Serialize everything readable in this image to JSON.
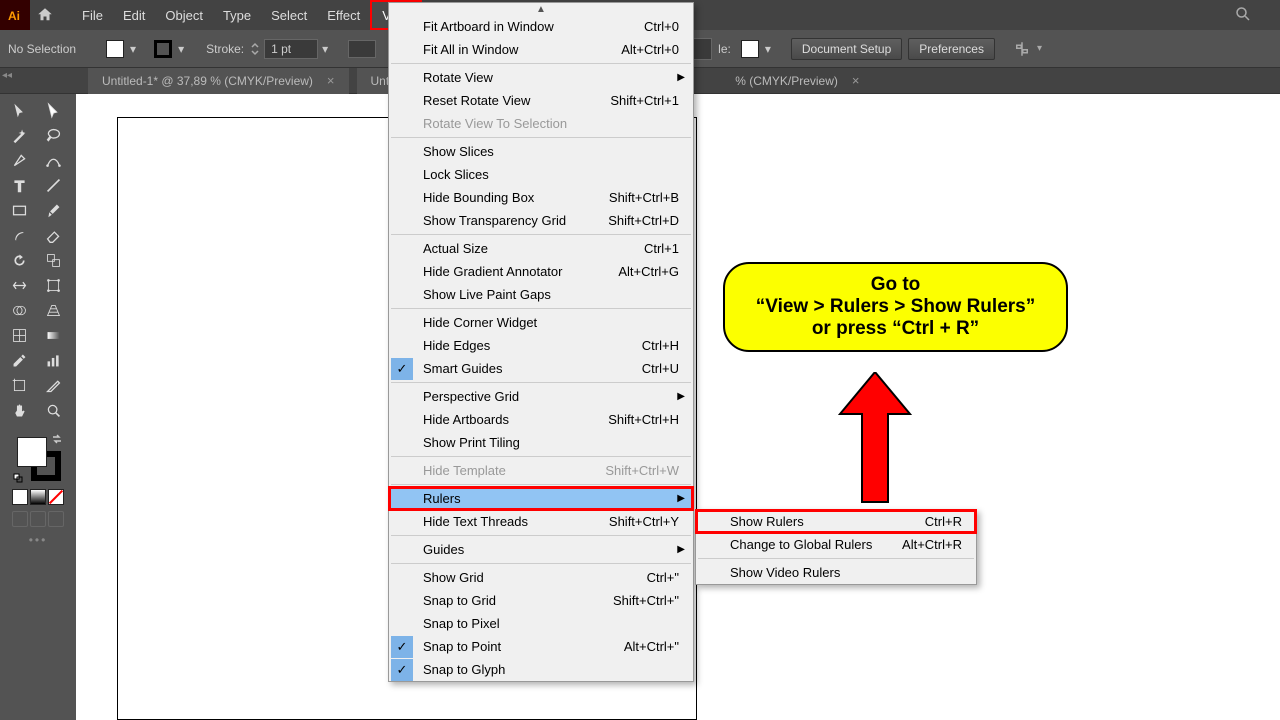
{
  "menubar": {
    "items": [
      "File",
      "Edit",
      "Object",
      "Type",
      "Select",
      "Effect",
      "View"
    ],
    "highlighted": "View"
  },
  "controlbar": {
    "selection": "No Selection",
    "stroke_label": "Stroke:",
    "stroke_value": "1 pt",
    "style_suffix": "le:",
    "btn_document_setup": "Document Setup",
    "btn_preferences": "Preferences"
  },
  "tabs": [
    {
      "label": "Untitled-1* @ 37,89 % (CMYK/Preview)"
    },
    {
      "label": "Untitled",
      "truncated": true
    },
    {
      "suffix": "% (CMYK/Preview)"
    }
  ],
  "view_menu": [
    {
      "type": "item",
      "label": "Fit Artboard in Window",
      "shortcut": "Ctrl+0"
    },
    {
      "type": "item",
      "label": "Fit All in Window",
      "shortcut": "Alt+Ctrl+0"
    },
    {
      "type": "sep"
    },
    {
      "type": "item",
      "label": "Rotate View",
      "submenu": true
    },
    {
      "type": "item",
      "label": "Reset Rotate View",
      "shortcut": "Shift+Ctrl+1"
    },
    {
      "type": "item",
      "label": "Rotate View To Selection",
      "disabled": true
    },
    {
      "type": "sep"
    },
    {
      "type": "item",
      "label": "Show Slices"
    },
    {
      "type": "item",
      "label": "Lock Slices"
    },
    {
      "type": "item",
      "label": "Hide Bounding Box",
      "shortcut": "Shift+Ctrl+B"
    },
    {
      "type": "item",
      "label": "Show Transparency Grid",
      "shortcut": "Shift+Ctrl+D"
    },
    {
      "type": "sep"
    },
    {
      "type": "item",
      "label": "Actual Size",
      "shortcut": "Ctrl+1"
    },
    {
      "type": "item",
      "label": "Hide Gradient Annotator",
      "shortcut": "Alt+Ctrl+G"
    },
    {
      "type": "item",
      "label": "Show Live Paint Gaps"
    },
    {
      "type": "sep"
    },
    {
      "type": "item",
      "label": "Hide Corner Widget"
    },
    {
      "type": "item",
      "label": "Hide Edges",
      "shortcut": "Ctrl+H"
    },
    {
      "type": "item",
      "label": "Smart Guides",
      "shortcut": "Ctrl+U",
      "checked": true
    },
    {
      "type": "sep"
    },
    {
      "type": "item",
      "label": "Perspective Grid",
      "submenu": true
    },
    {
      "type": "item",
      "label": "Hide Artboards",
      "shortcut": "Shift+Ctrl+H"
    },
    {
      "type": "item",
      "label": "Show Print Tiling"
    },
    {
      "type": "sep"
    },
    {
      "type": "item",
      "label": "Hide Template",
      "shortcut": "Shift+Ctrl+W",
      "disabled": true
    },
    {
      "type": "sep"
    },
    {
      "type": "item",
      "label": "Rulers",
      "submenu": true,
      "highlight": true,
      "boxed": true
    },
    {
      "type": "item",
      "label": "Hide Text Threads",
      "shortcut": "Shift+Ctrl+Y"
    },
    {
      "type": "sep"
    },
    {
      "type": "item",
      "label": "Guides",
      "submenu": true
    },
    {
      "type": "sep"
    },
    {
      "type": "item",
      "label": "Show Grid",
      "shortcut": "Ctrl+\""
    },
    {
      "type": "item",
      "label": "Snap to Grid",
      "shortcut": "Shift+Ctrl+\""
    },
    {
      "type": "item",
      "label": "Snap to Pixel"
    },
    {
      "type": "item",
      "label": "Snap to Point",
      "shortcut": "Alt+Ctrl+\"",
      "checked": true
    },
    {
      "type": "item",
      "label": "Snap to Glyph",
      "checked": true
    }
  ],
  "rulers_submenu": [
    {
      "label": "Show Rulers",
      "shortcut": "Ctrl+R",
      "boxed": true
    },
    {
      "label": "Change to Global Rulers",
      "shortcut": "Alt+Ctrl+R"
    },
    {
      "type": "sep"
    },
    {
      "label": "Show Video Rulers"
    }
  ],
  "callout": {
    "line1": "Go to",
    "line2": "“View > Rulers > Show Rulers”",
    "line3": "or press “Ctrl + R”"
  },
  "tools": [
    [
      "selection-tool",
      "direct-selection-tool"
    ],
    [
      "magic-wand-tool",
      "lasso-tool"
    ],
    [
      "pen-tool",
      "curvature-tool"
    ],
    [
      "type-tool",
      "line-tool"
    ],
    [
      "rectangle-tool",
      "paintbrush-tool"
    ],
    [
      "shaper-tool",
      "eraser-tool"
    ],
    [
      "rotate-tool",
      "scale-tool"
    ],
    [
      "width-tool",
      "free-transform-tool"
    ],
    [
      "shape-builder-tool",
      "perspective-tool"
    ],
    [
      "mesh-tool",
      "gradient-tool"
    ],
    [
      "eyedropper-tool",
      "chart-tool"
    ],
    [
      "artboard-tool",
      "slice-tool"
    ],
    [
      "hand-tool",
      "zoom-tool"
    ]
  ]
}
